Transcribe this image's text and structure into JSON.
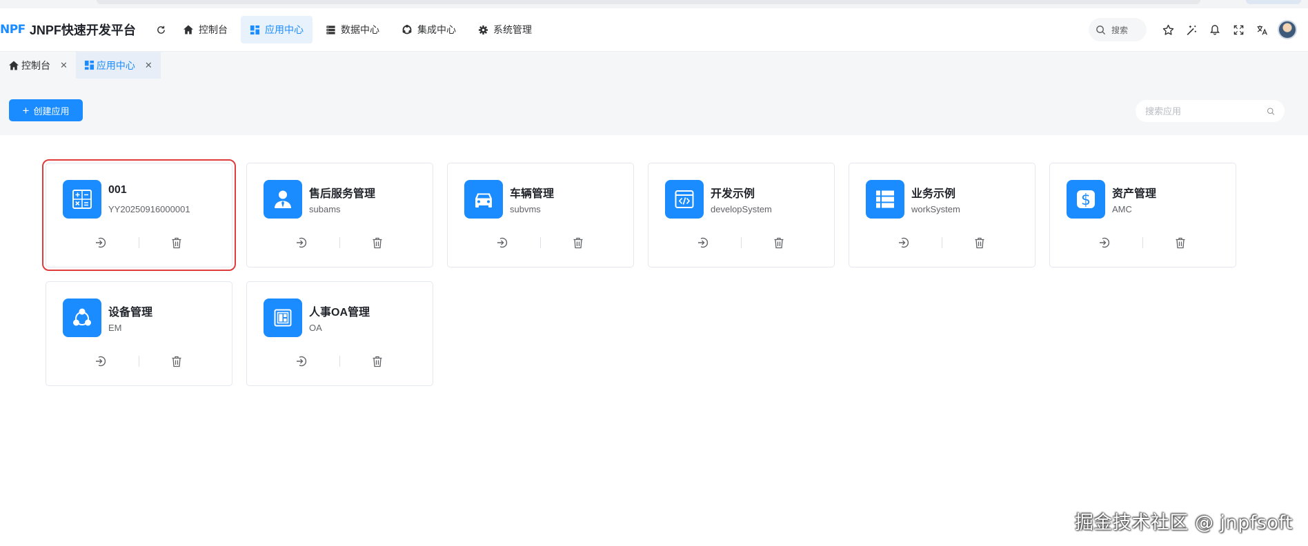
{
  "header": {
    "logo_mark": "NPF",
    "title": "JNPF快速开发平台",
    "nav": [
      {
        "label": "控制台",
        "icon": "home-icon",
        "active": false
      },
      {
        "label": "应用中心",
        "icon": "dashboard-icon",
        "active": true
      },
      {
        "label": "数据中心",
        "icon": "database-icon",
        "active": false
      },
      {
        "label": "集成中心",
        "icon": "integration-icon",
        "active": false
      },
      {
        "label": "系统管理",
        "icon": "gear-icon",
        "active": false
      }
    ],
    "search_label": "搜索"
  },
  "tabs": [
    {
      "label": "控制台",
      "icon": "home-icon",
      "active": false
    },
    {
      "label": "应用中心",
      "icon": "dashboard-icon",
      "active": true
    }
  ],
  "toolbar": {
    "create_label": "创建应用",
    "search_placeholder": "搜索应用"
  },
  "apps": [
    {
      "title": "001",
      "code": "YY20250916000001",
      "icon": "calculator-icon",
      "selected": true
    },
    {
      "title": "售后服务管理",
      "code": "subams",
      "icon": "service-person-icon",
      "selected": false
    },
    {
      "title": "车辆管理",
      "code": "subvms",
      "icon": "car-icon",
      "selected": false
    },
    {
      "title": "开发示例",
      "code": "developSystem",
      "icon": "code-window-icon",
      "selected": false
    },
    {
      "title": "业务示例",
      "code": "workSystem",
      "icon": "list-table-icon",
      "selected": false
    },
    {
      "title": "资产管理",
      "code": "AMC",
      "icon": "dollar-icon",
      "selected": false
    },
    {
      "title": "设备管理",
      "code": "EM",
      "icon": "device-network-icon",
      "selected": false
    },
    {
      "title": "人事OA管理",
      "code": "OA",
      "icon": "oa-grid-icon",
      "selected": false
    }
  ],
  "watermark": "掘金技术社区 @ jnpfsoft",
  "colors": {
    "accent": "#1a8cff",
    "highlight": "#e03b3b"
  }
}
